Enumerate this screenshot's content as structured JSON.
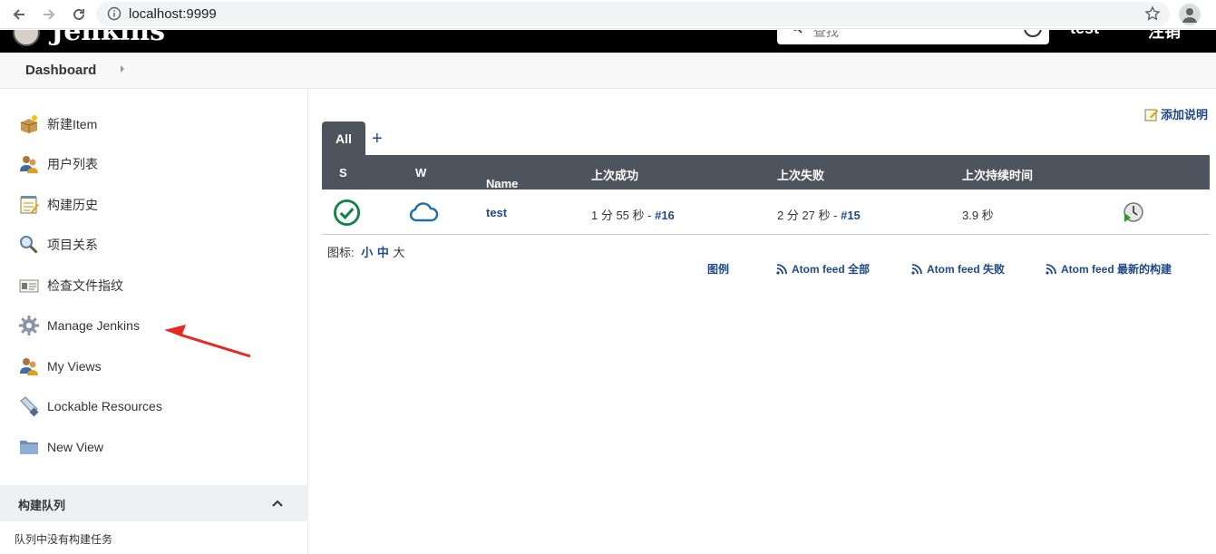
{
  "browser": {
    "url": "localhost:9999"
  },
  "header": {
    "title": "Jenkins",
    "search_placeholder": "查找",
    "user": "test",
    "logout": "注销"
  },
  "breadcrumb": {
    "label": "Dashboard"
  },
  "sidebar": {
    "items": [
      {
        "label": "新建Item",
        "icon": "new-package-icon"
      },
      {
        "label": "用户列表",
        "icon": "users-icon"
      },
      {
        "label": "构建历史",
        "icon": "notepad-icon"
      },
      {
        "label": "项目关系",
        "icon": "magnifier-icon"
      },
      {
        "label": "检查文件指纹",
        "icon": "fingerprint-icon"
      },
      {
        "label": "Manage Jenkins",
        "icon": "gear-icon"
      },
      {
        "label": "My Views",
        "icon": "users-icon"
      },
      {
        "label": "Lockable Resources",
        "icon": "usb-icon"
      },
      {
        "label": "New View",
        "icon": "folder-icon"
      }
    ],
    "queue_title": "构建队列",
    "queue_empty": "队列中没有构建任务"
  },
  "main": {
    "add_description": "添加说明",
    "tab_all": "All",
    "tab_add": "+",
    "columns": [
      "S",
      "W",
      "Name",
      "上次成功",
      "上次失败",
      "上次持续时间"
    ],
    "name_sort_arrow": "↓",
    "rows": [
      {
        "status": "success",
        "weather": "cloudy",
        "name": "test",
        "last_success_time": "1 分 55 秒 - ",
        "last_success_build": "#16",
        "last_failure_time": "2 分 27 秒 - ",
        "last_failure_build": "#15",
        "duration": "3.9 秒"
      }
    ],
    "icon_label": "图标:",
    "icon_small": "小",
    "icon_medium": "中",
    "icon_large": "大",
    "legend": "图例",
    "atom_all": "Atom feed 全部",
    "atom_fail": "Atom feed 失败",
    "atom_latest": "Atom feed 最新的构建"
  },
  "colors": {
    "header_bg": "#000000",
    "table_head_bg": "#4d545d",
    "link": "#204a87",
    "success": "#138347",
    "annotation_arrow": "#e8291f"
  }
}
